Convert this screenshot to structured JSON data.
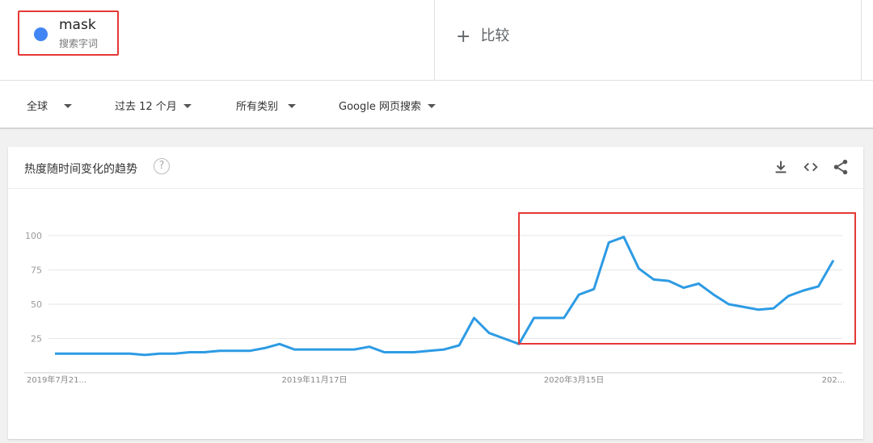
{
  "search_term": {
    "name": "mask",
    "type": "搜索字词",
    "dot_color": "#4285f4"
  },
  "compare": {
    "plus": "+",
    "label": "比较"
  },
  "filters": {
    "region": "全球",
    "time": "过去 12 个月",
    "category": "所有类别",
    "property": "Google 网页搜索"
  },
  "card": {
    "title": "热度随时间变化的趋势",
    "help": "?"
  },
  "icons": [
    "download-icon",
    "embed-code-icon",
    "share-icon"
  ],
  "chart_data": {
    "type": "line",
    "ylim": [
      0,
      100
    ],
    "yticks": [
      25,
      50,
      75,
      100
    ],
    "xtick_labels": [
      "2019年7月21...",
      "2019年11月17日",
      "2020年3月15日",
      "202..."
    ],
    "line_color": "#2d9be4",
    "grid": true,
    "series": [
      {
        "values": [
          14,
          14,
          14,
          14,
          14,
          14,
          13,
          14,
          14,
          15,
          15,
          16,
          16,
          16,
          18,
          21,
          17,
          17,
          17,
          17,
          17,
          19,
          15,
          15,
          15,
          16,
          17,
          20,
          40,
          29,
          25,
          21,
          40,
          40,
          40,
          57,
          61,
          95,
          99,
          76,
          68,
          67,
          62,
          65,
          57,
          50,
          48,
          46,
          47,
          56,
          60,
          63,
          82
        ]
      }
    ]
  }
}
